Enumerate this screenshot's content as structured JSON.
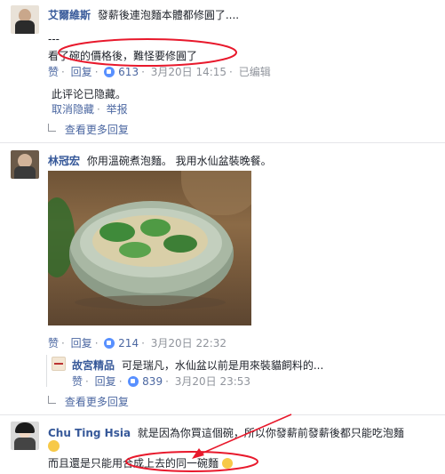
{
  "comments": [
    {
      "author": "艾爾維斯",
      "text": "發薪後連泡麵本體都修圓了....",
      "text2": "---",
      "text3": "看了碗的價格後，難怪要修圓了",
      "actions": {
        "like": "赞",
        "reply": "回复",
        "count": "613",
        "time": "3月20日 14:15",
        "edited": "已编辑"
      }
    },
    {
      "hidden_notice": "此评论已隐藏。",
      "undo": "取消隐藏",
      "report": "举报",
      "more_replies": "查看更多回复"
    },
    {
      "author": "林冠宏",
      "text": "你用溫碗煮泡麵。 我用水仙盆裝晚餐。",
      "actions": {
        "like": "赞",
        "reply": "回复",
        "count": "214",
        "time": "3月20日 22:32"
      },
      "reply": {
        "author": "故宮精品",
        "text": "可是瑞凡，水仙盆以前是用來裝貓飼料的...",
        "actions": {
          "like": "赞",
          "reply": "回复",
          "count": "839",
          "time": "3月20日 23:53"
        }
      },
      "more_replies": "查看更多回复"
    },
    {
      "author": "Chu Ting Hsia",
      "text": "就是因為你買這個碗，所以你發薪前發薪後都只能吃泡麵",
      "text2": "而且還是只能用合成上去的同一碗麵"
    }
  ],
  "colors": {
    "accent": "#365899",
    "annotation": "#e8192c",
    "like": "#5890ff"
  }
}
